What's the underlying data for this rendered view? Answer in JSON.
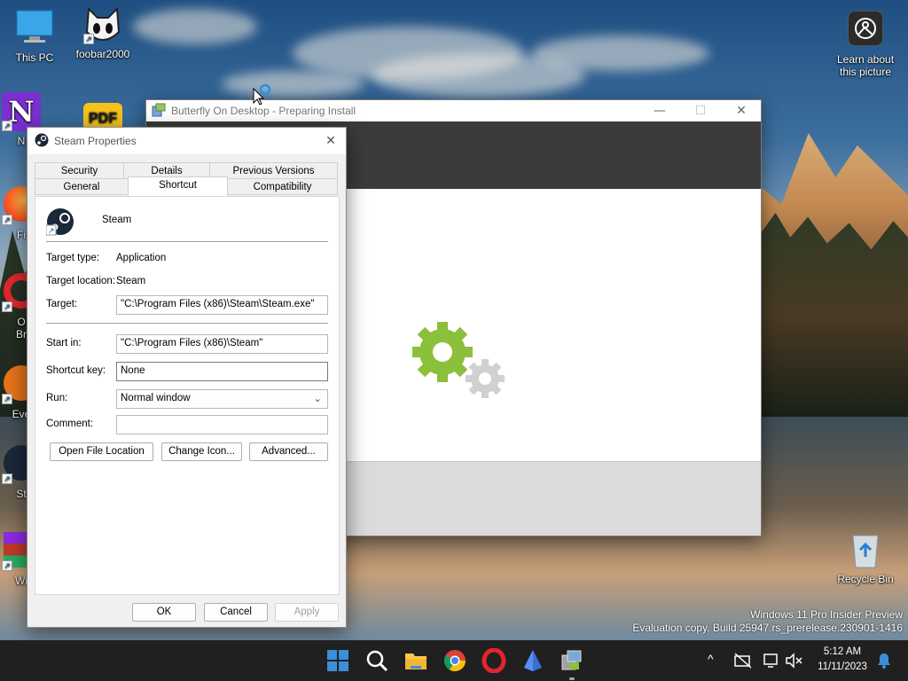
{
  "desktop": {
    "icons": [
      {
        "label": "This PC"
      },
      {
        "label": "foobar2000"
      },
      {
        "label": "N"
      },
      {
        "label": "Fi"
      },
      {
        "label": "O"
      },
      {
        "label": "Br"
      },
      {
        "label": "Eve"
      },
      {
        "label": "St"
      },
      {
        "label": "Wi"
      }
    ],
    "learn": {
      "line1": "Learn about",
      "line2": "this picture"
    },
    "recycle_bin": {
      "label": "Recycle Bin"
    },
    "pdf_label": "PDF",
    "watermark": {
      "line1": "Windows 11 Pro Insider Preview",
      "line2": "Evaluation copy. Build 25947.rs_prerelease.230901-1416"
    }
  },
  "butterfly_window": {
    "title": "Butterfly On Desktop - Preparing Install",
    "controls": {
      "minimize": "—",
      "maximize": "☐",
      "close": "✕"
    },
    "gear_color": "#8cbf3a"
  },
  "properties_dialog": {
    "title": "Steam Properties",
    "close": "✕",
    "tabs_row1": [
      "Security",
      "Details",
      "Previous Versions"
    ],
    "tabs_row2": [
      "General",
      "Shortcut",
      "Compatibility"
    ],
    "active_tab": "Shortcut",
    "app_name": "Steam",
    "target_type_label": "Target type:",
    "target_type_value": "Application",
    "target_location_label": "Target location:",
    "target_location_value": "Steam",
    "target_label": "Target:",
    "target_value": "\"C:\\Program Files (x86)\\Steam\\Steam.exe\"",
    "start_in_label": "Start in:",
    "start_in_value": "\"C:\\Program Files (x86)\\Steam\"",
    "shortcut_key_label": "Shortcut key:",
    "shortcut_key_value": "None",
    "run_label": "Run:",
    "run_value": "Normal window",
    "comment_label": "Comment:",
    "comment_value": "",
    "buttons": {
      "open_file_location": "Open File Location",
      "change_icon": "Change Icon...",
      "advanced": "Advanced...",
      "ok": "OK",
      "cancel": "Cancel",
      "apply": "Apply"
    }
  },
  "taskbar": {
    "apps": [
      "start-icon",
      "search-icon",
      "file-explorer-icon",
      "chrome-icon",
      "opera-icon",
      "app-icon",
      "installer-icon"
    ],
    "chevron": "^",
    "time": "5:12 AM",
    "date": "11/11/2023",
    "accent": "#3b8ed8"
  }
}
